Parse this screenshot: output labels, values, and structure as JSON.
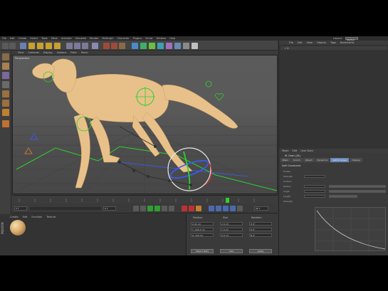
{
  "menubar": {
    "items": [
      "File",
      "Edit",
      "Create",
      "Select",
      "Tools",
      "Mesh",
      "Animate",
      "Simulate",
      "Render",
      "MoGraph",
      "Character",
      "Plugins",
      "Script",
      "Window",
      "Help"
    ],
    "layout_label": "Layout:",
    "layout_value": "Startup"
  },
  "viewport": {
    "menu": [
      "View",
      "Cameras",
      "Display",
      "Options",
      "Filter",
      "Panel"
    ],
    "label": "Perspective"
  },
  "object_manager": {
    "tabs": [
      "File",
      "Edit",
      "View",
      "Objects",
      "Tags",
      "Bookmarks"
    ],
    "object": "L Ik"
  },
  "attributes": {
    "menu": [
      "Mode",
      "Edit",
      "User Data"
    ],
    "object_title": "IK Chain [IK]",
    "tabs": [
      "Basic",
      "Coord.",
      "Object",
      "Dynamics",
      "Soft IK Solver",
      "Display"
    ],
    "active_tab": "Soft IK Solver",
    "section": "Soft Constraint",
    "rows": [
      "Enable",
      "Strength",
      "Surface",
      "Radius",
      "Angle",
      "Length",
      "Strength"
    ]
  },
  "material_manager": {
    "menu": [
      "Create",
      "Edit",
      "Function",
      "Texture"
    ],
    "logo": "MAXON"
  },
  "coordinates": {
    "headers": [
      "Position",
      "Size",
      "Rotation"
    ],
    "pos": [
      "X  41 cm",
      "Y  -105.3 cm",
      "Z  -116 cm"
    ],
    "size": [
      "X  0 cm",
      "Y  0 cm",
      "Z  0 cm"
    ],
    "rot": [
      "H  0°",
      "P  0°",
      "B  0°"
    ],
    "mode_btn": "Object (Rel)",
    "size_btn": "Size",
    "apply_btn": "Apply"
  },
  "timeline": {
    "start": "0 F",
    "end": "90 F",
    "current": "0 F"
  },
  "colors": {
    "horse": "#e8c18a",
    "ik_green": "#2ed12e",
    "ik_blue": "#3a5cff",
    "accent": "#e8a050"
  }
}
